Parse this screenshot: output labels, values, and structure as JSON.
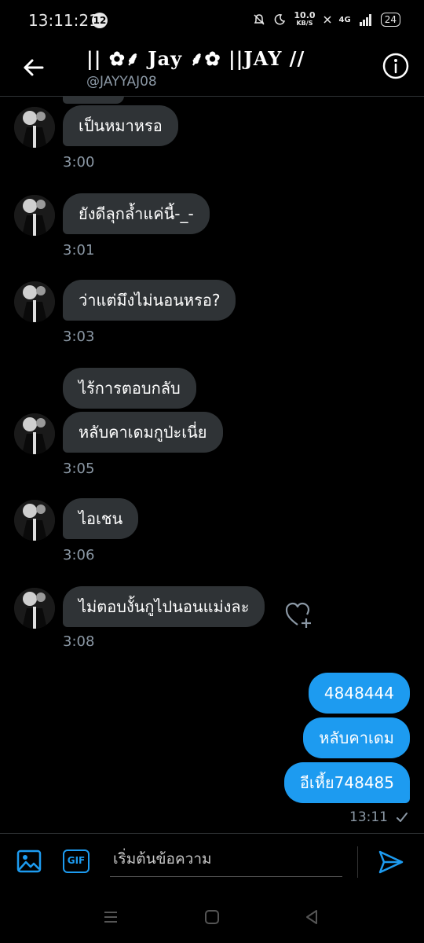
{
  "status_bar": {
    "time": "13:11:21",
    "notification_count": "12",
    "speed_value": "10.0",
    "speed_unit": "KB/S",
    "network": "4G",
    "battery": "24"
  },
  "header": {
    "title": "|| ✿⸙ Jay ⸙✿ ||JAY //",
    "handle": "@JAYYAJ08"
  },
  "messages": [
    {
      "text": "เป็นหมาหรอ",
      "time": "3:00"
    },
    {
      "text": "ยังดีลุกล้ำแค่นี้-_-",
      "time": "3:01"
    },
    {
      "text": "ว่าแต่มึงไม่นอนหรอ?",
      "time": "3:03"
    },
    {
      "text": "ไร้การตอบกลับ",
      "time": ""
    },
    {
      "text": "หลับคาเดมกูป่ะเนี่ย",
      "time": "3:05"
    },
    {
      "text": "ไอเชน",
      "time": "3:06"
    },
    {
      "text": "ไม่ตอบงั้นกูไปนอนแม่งละ",
      "time": "3:08"
    }
  ],
  "sent": [
    {
      "text": "4848444"
    },
    {
      "text": "หลับคาเดม"
    },
    {
      "text": "อีเหี้ย748485"
    }
  ],
  "sent_time": "13:11",
  "composer": {
    "gif_label": "GIF",
    "placeholder": "เริ่มต้นข้อความ"
  },
  "colors": {
    "accent": "#1d9bf0",
    "bubble_in": "#2f3336",
    "background": "#000000"
  },
  "icons": [
    "back-arrow-icon",
    "info-icon",
    "heart-plus-icon",
    "image-icon",
    "gif-icon",
    "send-icon",
    "check-icon"
  ]
}
